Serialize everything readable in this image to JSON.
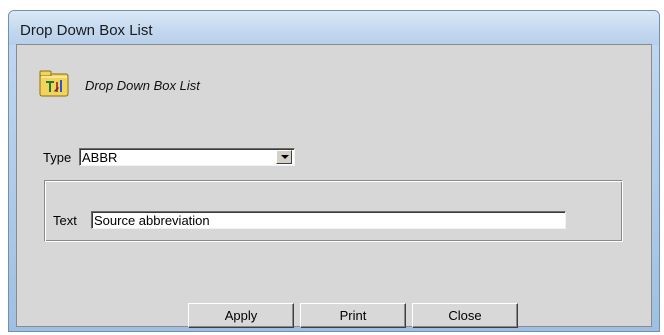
{
  "window": {
    "title": "Drop Down Box List"
  },
  "header": {
    "icon": "folder-tools-icon",
    "label": "Drop Down Box List"
  },
  "type_field": {
    "label": "Type",
    "value": "ABBR"
  },
  "text_field": {
    "label": "Text",
    "value": "Source abbreviation"
  },
  "buttons": {
    "apply": "Apply",
    "print": "Print",
    "close": "Close"
  },
  "colors": {
    "titlebar": "#c4d9ef",
    "dialog_background": "#d7d7d7",
    "icon_folder": "#f3d35a"
  }
}
